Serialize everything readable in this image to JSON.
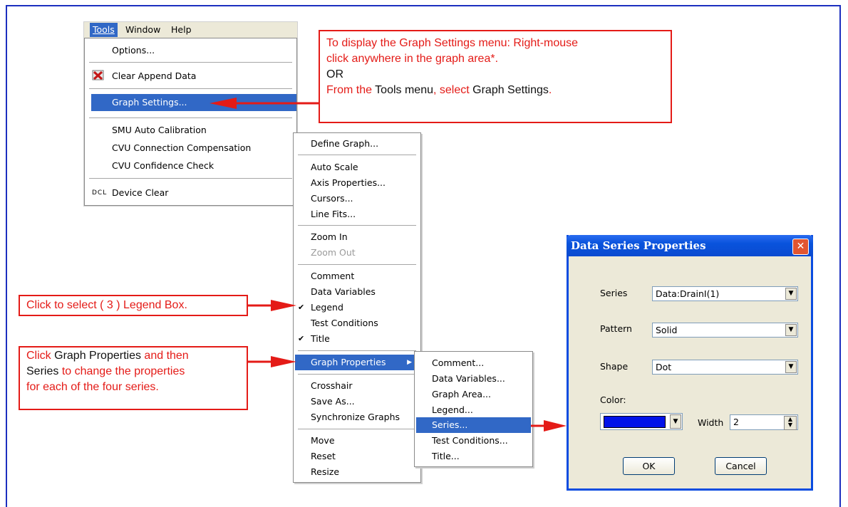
{
  "tools_menu": {
    "menubar": [
      "Tools",
      "Window",
      "Help"
    ],
    "items": [
      "Options...",
      "Clear Append Data",
      "Graph Settings...",
      "SMU Auto Calibration",
      "CVU Connection Compensation",
      "CVU Confidence Check",
      "Device Clear"
    ],
    "dcl_icon_text": "DCL"
  },
  "graph_menu": {
    "items": [
      "Define Graph...",
      "Auto Scale",
      "Axis Properties...",
      "Cursors...",
      "Line Fits...",
      "Zoom In",
      "Zoom Out",
      "Comment",
      "Data Variables",
      "Legend",
      "Test Conditions",
      "Title",
      "Graph Properties",
      "Crosshair",
      "Save As...",
      "Synchronize Graphs",
      "Move",
      "Reset",
      "Resize"
    ]
  },
  "graph_props_menu": {
    "items": [
      "Comment...",
      "Data Variables...",
      "Graph Area...",
      "Legend...",
      "Series...",
      "Test Conditions...",
      "Title..."
    ]
  },
  "callouts": {
    "top_line1": "To display the Graph Settings menu:  Right-mouse",
    "top_line2": "click anywhere in the graph area*.",
    "top_or": "OR",
    "top_from": "From the",
    "top_tools": "Tools menu",
    "top_select": ", select",
    "top_gs": "Graph Settings",
    "top_dot": ".",
    "legend_text": "Click to select ( 3 ) Legend Box.",
    "series_click": "Click",
    "series_gp": "Graph Properties",
    "series_andthen": "and then",
    "series_series": "Series",
    "series_rest1": "to change the properties",
    "series_rest2": "for each of the four series."
  },
  "dialog": {
    "title": "Data Series Properties",
    "series_label": "Series",
    "series_value": "Data:DrainI(1)",
    "pattern_label": "Pattern",
    "pattern_value": "Solid",
    "shape_label": "Shape",
    "shape_value": "Dot",
    "color_label": "Color:",
    "color_value": "#0012e8",
    "width_label": "Width",
    "width_value": "2",
    "ok": "OK",
    "cancel": "Cancel"
  },
  "colors": {
    "callout_red": "#e41b17",
    "menu_highlight": "#3168c6",
    "frame_blue": "#1c2fbf"
  }
}
